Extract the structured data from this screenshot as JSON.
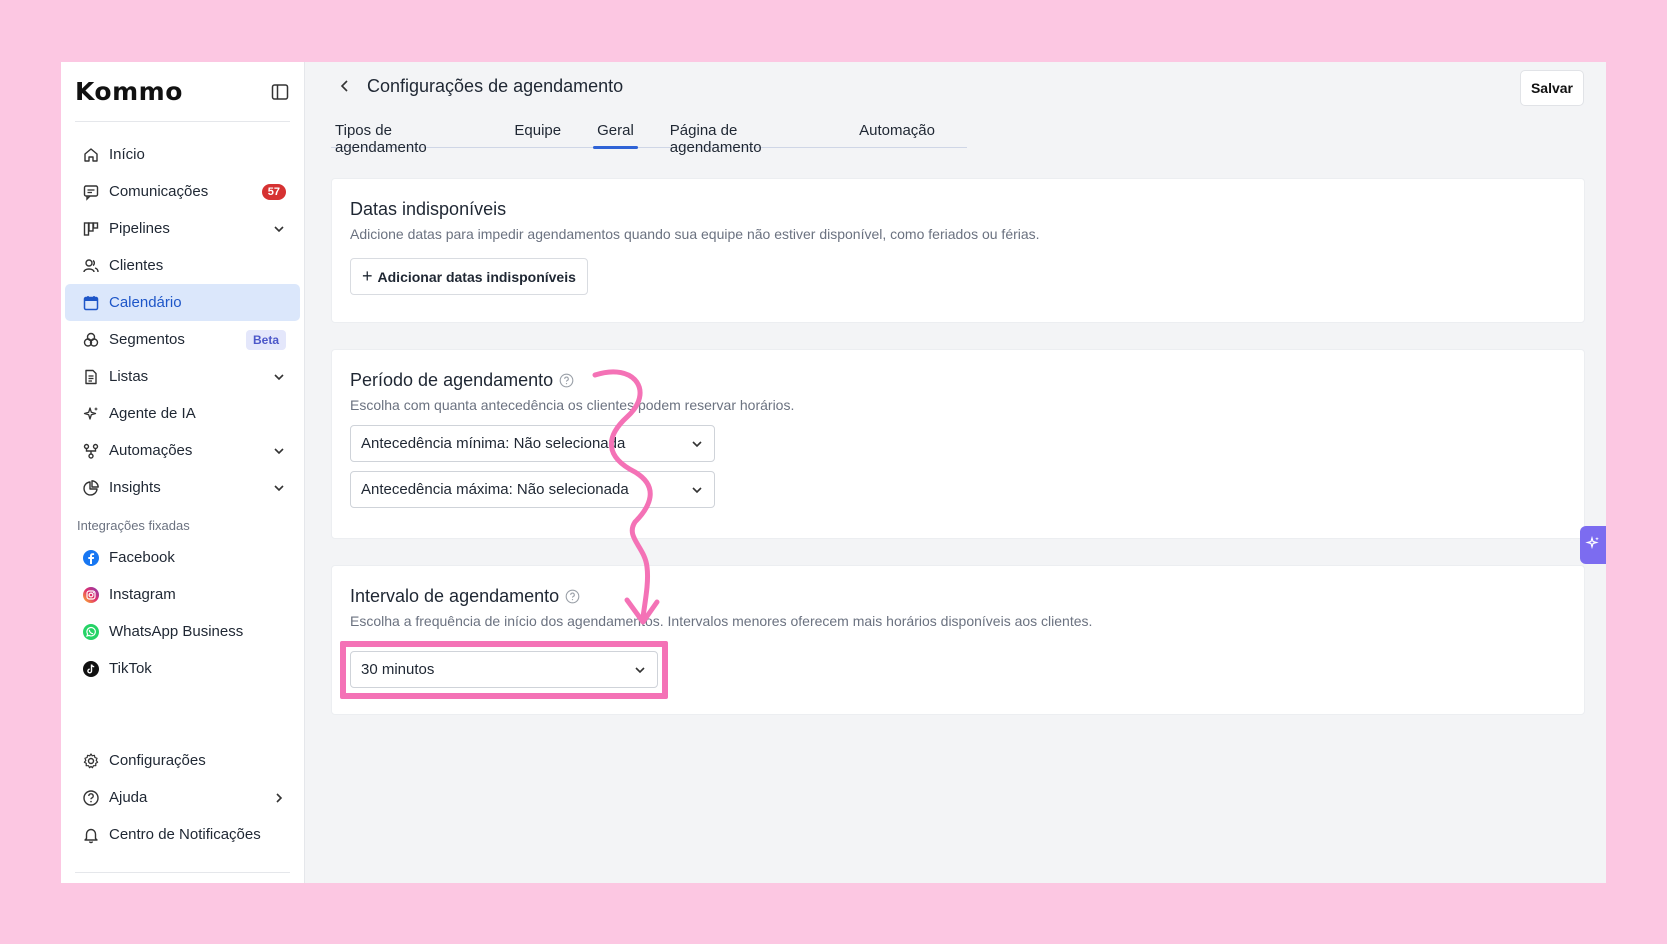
{
  "sidebar": {
    "logo": "Kommo",
    "items": [
      {
        "label": "Início"
      },
      {
        "label": "Comunicações",
        "badge": "57"
      },
      {
        "label": "Pipelines"
      },
      {
        "label": "Clientes"
      },
      {
        "label": "Calendário"
      },
      {
        "label": "Segmentos",
        "badge": "Beta"
      },
      {
        "label": "Listas"
      },
      {
        "label": "Agente de IA"
      },
      {
        "label": "Automações"
      },
      {
        "label": "Insights"
      }
    ],
    "pinned_label": "Integrações fixadas",
    "pinned": [
      {
        "label": "Facebook",
        "color": "#1877f2"
      },
      {
        "label": "Instagram",
        "color": "#e1306c"
      },
      {
        "label": "WhatsApp Business",
        "color": "#25d366"
      },
      {
        "label": "TikTok",
        "color": "#111111"
      }
    ],
    "bottom": [
      {
        "label": "Configurações"
      },
      {
        "label": "Ajuda"
      },
      {
        "label": "Centro de Notificações"
      }
    ]
  },
  "header": {
    "title": "Configurações de agendamento",
    "save_label": "Salvar"
  },
  "tabs": [
    {
      "label": "Tipos de agendamento"
    },
    {
      "label": "Equipe"
    },
    {
      "label": "Geral",
      "active": true
    },
    {
      "label": "Página de agendamento"
    },
    {
      "label": "Automação"
    }
  ],
  "unavailable": {
    "title": "Datas indisponíveis",
    "desc": "Adicione datas para impedir agendamentos quando sua equipe não estiver disponível, como feriados ou férias.",
    "button_label": "Adicionar datas indisponíveis"
  },
  "period": {
    "title": "Período de agendamento",
    "desc": "Escolha com quanta antecedência os clientes podem reservar horários.",
    "min_value": "Antecedência mínima: Não selecionada",
    "max_value": "Antecedência máxima: Não selecionada"
  },
  "interval": {
    "title": "Intervalo de agendamento",
    "desc": "Escolha a frequência de início dos agendamentos. Intervalos menores oferecem mais horários disponíveis aos clientes.",
    "value": "30 minutos"
  },
  "colors": {
    "accent": "#2f63d6",
    "active_bg": "#dbe7fb",
    "highlight": "#f472b6",
    "page_bg": "#fcc7e2"
  }
}
